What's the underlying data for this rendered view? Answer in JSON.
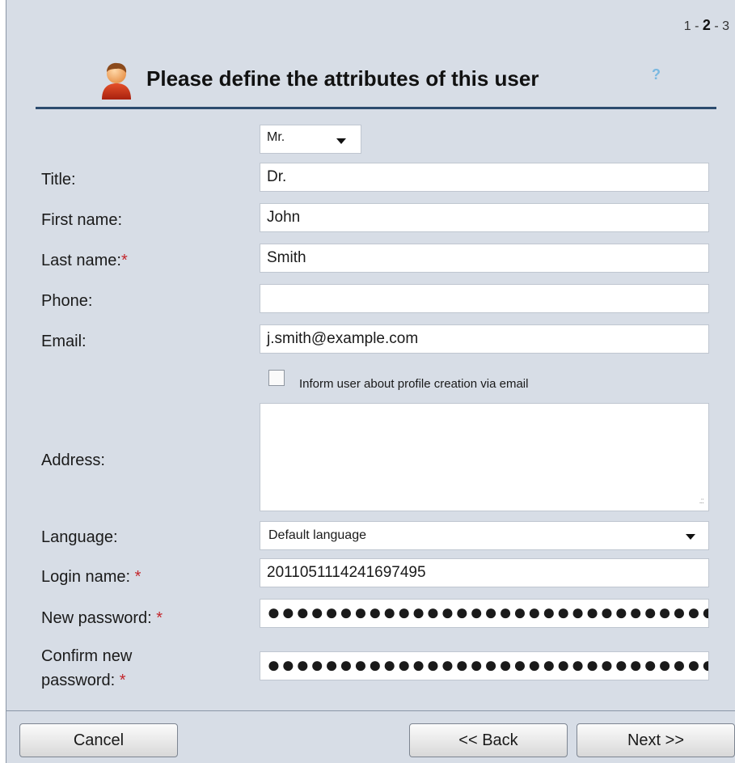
{
  "step_indicator": {
    "prefix": "1 - ",
    "current": "2",
    "suffix": " - 3"
  },
  "header": {
    "title": "Please define the attributes of this user",
    "help": "?"
  },
  "form": {
    "salutation": {
      "value": "Mr."
    },
    "title": {
      "label": "Title:",
      "value": "Dr."
    },
    "first_name": {
      "label": "First name:",
      "value": "John"
    },
    "last_name": {
      "label": "Last name:",
      "required": "*",
      "value": "Smith"
    },
    "phone": {
      "label": "Phone:",
      "value": ""
    },
    "email": {
      "label": "Email:",
      "value": "j.smith@example.com"
    },
    "inform_user": {
      "label": "Inform user about profile creation via email",
      "checked": false
    },
    "address": {
      "label": "Address:",
      "value": ""
    },
    "language": {
      "label": "Language:",
      "value": "Default language"
    },
    "login_name": {
      "label": "Login name: ",
      "required": "*",
      "value": "20110511142416974​95"
    },
    "new_password": {
      "label": "New password: ",
      "required": "*",
      "value": "●●●●●●●●●●●●●●●●●●●●●●●●●●●●●●●●"
    },
    "confirm_password": {
      "label_line1": "Confirm new",
      "label_line2": "password: ",
      "required": "*",
      "value": "●●●●●●●●●●●●●●●●●●●●●●●●●●●●●●●●"
    }
  },
  "buttons": {
    "cancel": "Cancel",
    "back": "<<  Back",
    "next": "Next >>"
  },
  "icons": {
    "avatar": "user-avatar-icon",
    "help": "help-icon",
    "dropdown": "chevron-down-icon",
    "resize": "resize-grip-icon"
  },
  "colors": {
    "panel": "#d7dde6",
    "header_rule": "#2c4b6e",
    "required": "#c3262c",
    "help": "#7ab8e0"
  }
}
